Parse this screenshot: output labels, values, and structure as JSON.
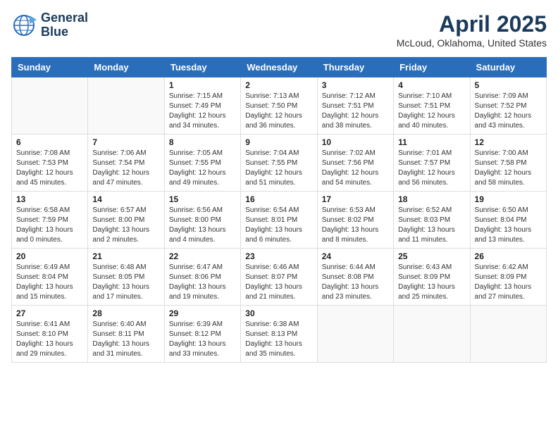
{
  "header": {
    "logo_line1": "General",
    "logo_line2": "Blue",
    "month_year": "April 2025",
    "location": "McLoud, Oklahoma, United States"
  },
  "weekdays": [
    "Sunday",
    "Monday",
    "Tuesday",
    "Wednesday",
    "Thursday",
    "Friday",
    "Saturday"
  ],
  "weeks": [
    [
      {
        "day": "",
        "sunrise": "",
        "sunset": "",
        "daylight": "",
        "empty": true
      },
      {
        "day": "",
        "sunrise": "",
        "sunset": "",
        "daylight": "",
        "empty": true
      },
      {
        "day": "1",
        "sunrise": "Sunrise: 7:15 AM",
        "sunset": "Sunset: 7:49 PM",
        "daylight": "Daylight: 12 hours and 34 minutes."
      },
      {
        "day": "2",
        "sunrise": "Sunrise: 7:13 AM",
        "sunset": "Sunset: 7:50 PM",
        "daylight": "Daylight: 12 hours and 36 minutes."
      },
      {
        "day": "3",
        "sunrise": "Sunrise: 7:12 AM",
        "sunset": "Sunset: 7:51 PM",
        "daylight": "Daylight: 12 hours and 38 minutes."
      },
      {
        "day": "4",
        "sunrise": "Sunrise: 7:10 AM",
        "sunset": "Sunset: 7:51 PM",
        "daylight": "Daylight: 12 hours and 40 minutes."
      },
      {
        "day": "5",
        "sunrise": "Sunrise: 7:09 AM",
        "sunset": "Sunset: 7:52 PM",
        "daylight": "Daylight: 12 hours and 43 minutes."
      }
    ],
    [
      {
        "day": "6",
        "sunrise": "Sunrise: 7:08 AM",
        "sunset": "Sunset: 7:53 PM",
        "daylight": "Daylight: 12 hours and 45 minutes."
      },
      {
        "day": "7",
        "sunrise": "Sunrise: 7:06 AM",
        "sunset": "Sunset: 7:54 PM",
        "daylight": "Daylight: 12 hours and 47 minutes."
      },
      {
        "day": "8",
        "sunrise": "Sunrise: 7:05 AM",
        "sunset": "Sunset: 7:55 PM",
        "daylight": "Daylight: 12 hours and 49 minutes."
      },
      {
        "day": "9",
        "sunrise": "Sunrise: 7:04 AM",
        "sunset": "Sunset: 7:55 PM",
        "daylight": "Daylight: 12 hours and 51 minutes."
      },
      {
        "day": "10",
        "sunrise": "Sunrise: 7:02 AM",
        "sunset": "Sunset: 7:56 PM",
        "daylight": "Daylight: 12 hours and 54 minutes."
      },
      {
        "day": "11",
        "sunrise": "Sunrise: 7:01 AM",
        "sunset": "Sunset: 7:57 PM",
        "daylight": "Daylight: 12 hours and 56 minutes."
      },
      {
        "day": "12",
        "sunrise": "Sunrise: 7:00 AM",
        "sunset": "Sunset: 7:58 PM",
        "daylight": "Daylight: 12 hours and 58 minutes."
      }
    ],
    [
      {
        "day": "13",
        "sunrise": "Sunrise: 6:58 AM",
        "sunset": "Sunset: 7:59 PM",
        "daylight": "Daylight: 13 hours and 0 minutes."
      },
      {
        "day": "14",
        "sunrise": "Sunrise: 6:57 AM",
        "sunset": "Sunset: 8:00 PM",
        "daylight": "Daylight: 13 hours and 2 minutes."
      },
      {
        "day": "15",
        "sunrise": "Sunrise: 6:56 AM",
        "sunset": "Sunset: 8:00 PM",
        "daylight": "Daylight: 13 hours and 4 minutes."
      },
      {
        "day": "16",
        "sunrise": "Sunrise: 6:54 AM",
        "sunset": "Sunset: 8:01 PM",
        "daylight": "Daylight: 13 hours and 6 minutes."
      },
      {
        "day": "17",
        "sunrise": "Sunrise: 6:53 AM",
        "sunset": "Sunset: 8:02 PM",
        "daylight": "Daylight: 13 hours and 8 minutes."
      },
      {
        "day": "18",
        "sunrise": "Sunrise: 6:52 AM",
        "sunset": "Sunset: 8:03 PM",
        "daylight": "Daylight: 13 hours and 11 minutes."
      },
      {
        "day": "19",
        "sunrise": "Sunrise: 6:50 AM",
        "sunset": "Sunset: 8:04 PM",
        "daylight": "Daylight: 13 hours and 13 minutes."
      }
    ],
    [
      {
        "day": "20",
        "sunrise": "Sunrise: 6:49 AM",
        "sunset": "Sunset: 8:04 PM",
        "daylight": "Daylight: 13 hours and 15 minutes."
      },
      {
        "day": "21",
        "sunrise": "Sunrise: 6:48 AM",
        "sunset": "Sunset: 8:05 PM",
        "daylight": "Daylight: 13 hours and 17 minutes."
      },
      {
        "day": "22",
        "sunrise": "Sunrise: 6:47 AM",
        "sunset": "Sunset: 8:06 PM",
        "daylight": "Daylight: 13 hours and 19 minutes."
      },
      {
        "day": "23",
        "sunrise": "Sunrise: 6:46 AM",
        "sunset": "Sunset: 8:07 PM",
        "daylight": "Daylight: 13 hours and 21 minutes."
      },
      {
        "day": "24",
        "sunrise": "Sunrise: 6:44 AM",
        "sunset": "Sunset: 8:08 PM",
        "daylight": "Daylight: 13 hours and 23 minutes."
      },
      {
        "day": "25",
        "sunrise": "Sunrise: 6:43 AM",
        "sunset": "Sunset: 8:09 PM",
        "daylight": "Daylight: 13 hours and 25 minutes."
      },
      {
        "day": "26",
        "sunrise": "Sunrise: 6:42 AM",
        "sunset": "Sunset: 8:09 PM",
        "daylight": "Daylight: 13 hours and 27 minutes."
      }
    ],
    [
      {
        "day": "27",
        "sunrise": "Sunrise: 6:41 AM",
        "sunset": "Sunset: 8:10 PM",
        "daylight": "Daylight: 13 hours and 29 minutes."
      },
      {
        "day": "28",
        "sunrise": "Sunrise: 6:40 AM",
        "sunset": "Sunset: 8:11 PM",
        "daylight": "Daylight: 13 hours and 31 minutes."
      },
      {
        "day": "29",
        "sunrise": "Sunrise: 6:39 AM",
        "sunset": "Sunset: 8:12 PM",
        "daylight": "Daylight: 13 hours and 33 minutes."
      },
      {
        "day": "30",
        "sunrise": "Sunrise: 6:38 AM",
        "sunset": "Sunset: 8:13 PM",
        "daylight": "Daylight: 13 hours and 35 minutes."
      },
      {
        "day": "",
        "sunrise": "",
        "sunset": "",
        "daylight": "",
        "empty": true
      },
      {
        "day": "",
        "sunrise": "",
        "sunset": "",
        "daylight": "",
        "empty": true
      },
      {
        "day": "",
        "sunrise": "",
        "sunset": "",
        "daylight": "",
        "empty": true
      }
    ]
  ]
}
